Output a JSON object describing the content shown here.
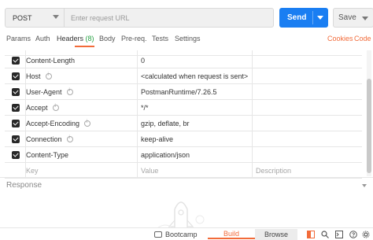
{
  "request": {
    "method": "POST",
    "url_placeholder": "Enter request URL",
    "send_label": "Send",
    "save_label": "Save"
  },
  "tabs": [
    {
      "label": "Params"
    },
    {
      "label": "Auth"
    },
    {
      "label": "Headers",
      "count": "(8)",
      "active": true
    },
    {
      "label": "Body"
    },
    {
      "label": "Pre-req."
    },
    {
      "label": "Tests"
    },
    {
      "label": "Settings"
    }
  ],
  "tab_links": {
    "cookies": "Cookies",
    "code": "Code"
  },
  "headers": {
    "rows": [
      {
        "key": "Content-Length",
        "value": "0",
        "info": false
      },
      {
        "key": "Host",
        "value": "<calculated when request is sent>",
        "info": true
      },
      {
        "key": "User-Agent",
        "value": "PostmanRuntime/7.26.5",
        "info": true
      },
      {
        "key": "Accept",
        "value": "*/*",
        "info": true
      },
      {
        "key": "Accept-Encoding",
        "value": "gzip, deflate, br",
        "info": true
      },
      {
        "key": "Connection",
        "value": "keep-alive",
        "info": true
      },
      {
        "key": "Content-Type",
        "value": "application/json",
        "info": false
      }
    ],
    "placeholders": {
      "key": "Key",
      "value": "Value",
      "description": "Description"
    }
  },
  "response": {
    "label": "Response"
  },
  "bottom": {
    "bootcamp": "Bootcamp",
    "build": "Build",
    "browse": "Browse"
  },
  "colors": {
    "accent": "#f26b3a",
    "send": "#1a7ef2",
    "count": "#27a243"
  },
  "icons": [
    "chevron-down-icon",
    "checkbox-checked-icon",
    "info-icon",
    "bootcamp-icon",
    "two-pane-icon",
    "find-replace-icon",
    "console-icon",
    "help-icon"
  ]
}
